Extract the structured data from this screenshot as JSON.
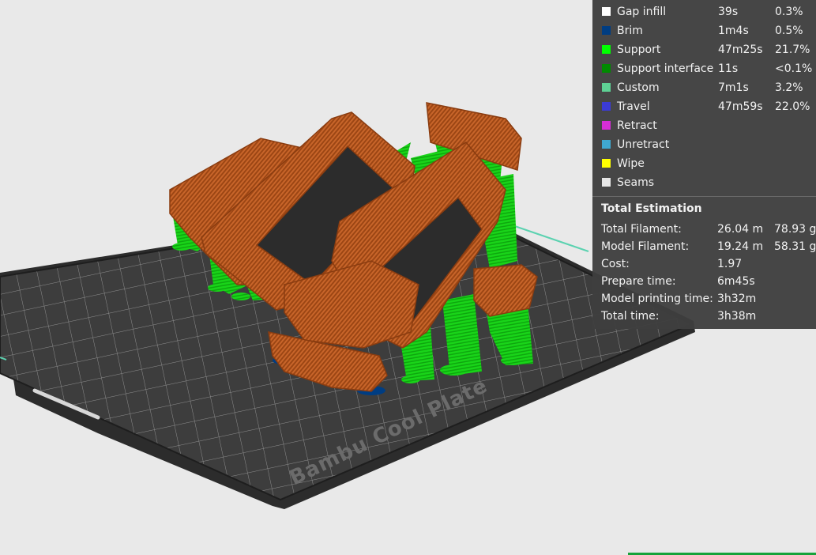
{
  "viewport": {
    "plate_label": "Bambu Cool Plate"
  },
  "legend": {
    "colors": {
      "gap_infill": "#ffffff",
      "brim": "#003d82",
      "support": "#00ff00",
      "support_interface": "#008a00",
      "custom": "#5ed194",
      "travel": "#3b3bd6",
      "retract": "#d62ed6",
      "unretract": "#3fa8d1",
      "wipe": "#ffff00",
      "seams": "#e6e6e6"
    },
    "items": [
      {
        "name": "Gap infill",
        "time": "39s",
        "percent": "0.3%"
      },
      {
        "name": "Brim",
        "time": "1m4s",
        "percent": "0.5%"
      },
      {
        "name": "Support",
        "time": "47m25s",
        "percent": "21.7%"
      },
      {
        "name": "Support interface",
        "time": "11s",
        "percent": "<0.1%"
      },
      {
        "name": "Custom",
        "time": "7m1s",
        "percent": "3.2%"
      },
      {
        "name": "Travel",
        "time": "47m59s",
        "percent": "22.0%"
      },
      {
        "name": "Retract",
        "time": "",
        "percent": ""
      },
      {
        "name": "Unretract",
        "time": "",
        "percent": ""
      },
      {
        "name": "Wipe",
        "time": "",
        "percent": ""
      },
      {
        "name": "Seams",
        "time": "",
        "percent": ""
      }
    ]
  },
  "estimation": {
    "heading": "Total Estimation",
    "total_filament": {
      "label": "Total Filament:",
      "length": "26.04 m",
      "weight": "78.93 g"
    },
    "model_filament": {
      "label": "Model Filament:",
      "length": "19.24 m",
      "weight": "58.31 g"
    },
    "cost": {
      "label": "Cost:",
      "value": "1.97"
    },
    "prepare_time": {
      "label": "Prepare time:",
      "value": "6m45s"
    },
    "model_printing_time": {
      "label": "Model printing time:",
      "value": "3h32m"
    },
    "total_time": {
      "label": "Total time:",
      "value": "3h38m"
    }
  }
}
